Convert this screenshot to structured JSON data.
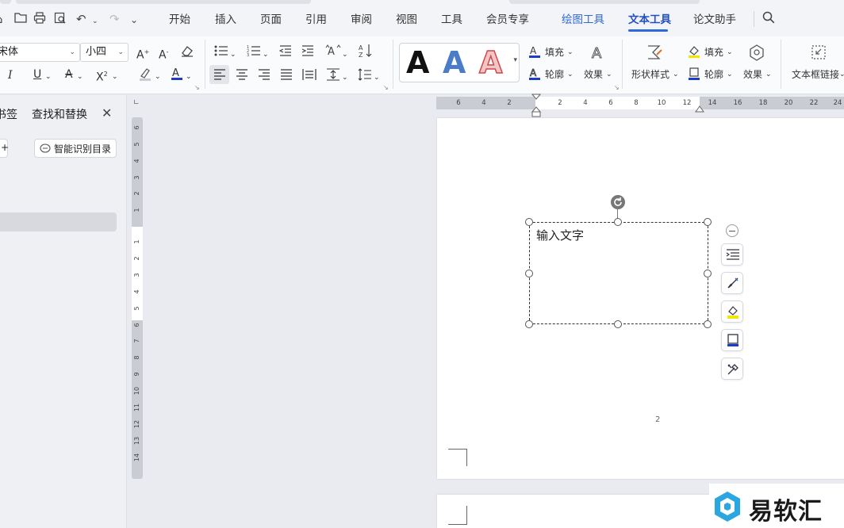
{
  "menu": {
    "items": [
      "开始",
      "插入",
      "页面",
      "引用",
      "审阅",
      "视图",
      "工具",
      "会员专享",
      "绘图工具",
      "文本工具",
      "论文助手"
    ]
  },
  "ribbon": {
    "font_name": "宋体",
    "font_size": "小四",
    "wordart_letter": "A",
    "fill_label": "填充",
    "outline_label": "轮廓",
    "effect_label": "效果",
    "shape_style_label": "形状样式",
    "shape_fill_label": "填充",
    "shape_outline_label": "轮廓",
    "shape_effect_label": "效果",
    "textbox_link_label": "文本框链接"
  },
  "panel": {
    "tab_bookmark": "书签",
    "tab_find_replace": "查找和替换",
    "smart_toc_button": "智能识别目录"
  },
  "ruler": {
    "h_ticks": [
      "6",
      "4",
      "2",
      "2",
      "4",
      "6",
      "8",
      "10",
      "12",
      "14",
      "16",
      "18",
      "20",
      "22",
      "24"
    ],
    "v_ticks_top": [
      "6",
      "5",
      "4",
      "3",
      "2",
      "1"
    ],
    "v_ticks_bottom": [
      "1",
      "2",
      "3",
      "4",
      "5",
      "6",
      "7",
      "8",
      "9",
      "10",
      "11",
      "12",
      "13",
      "14"
    ]
  },
  "document": {
    "textbox_text": "输入文字",
    "page_number": "2"
  },
  "watermark": {
    "brand": "易软汇"
  },
  "colors": {
    "accent": "#2f68d8",
    "fill_highlight": "#f5e400",
    "font_color_bar": "#1f3cc8"
  }
}
